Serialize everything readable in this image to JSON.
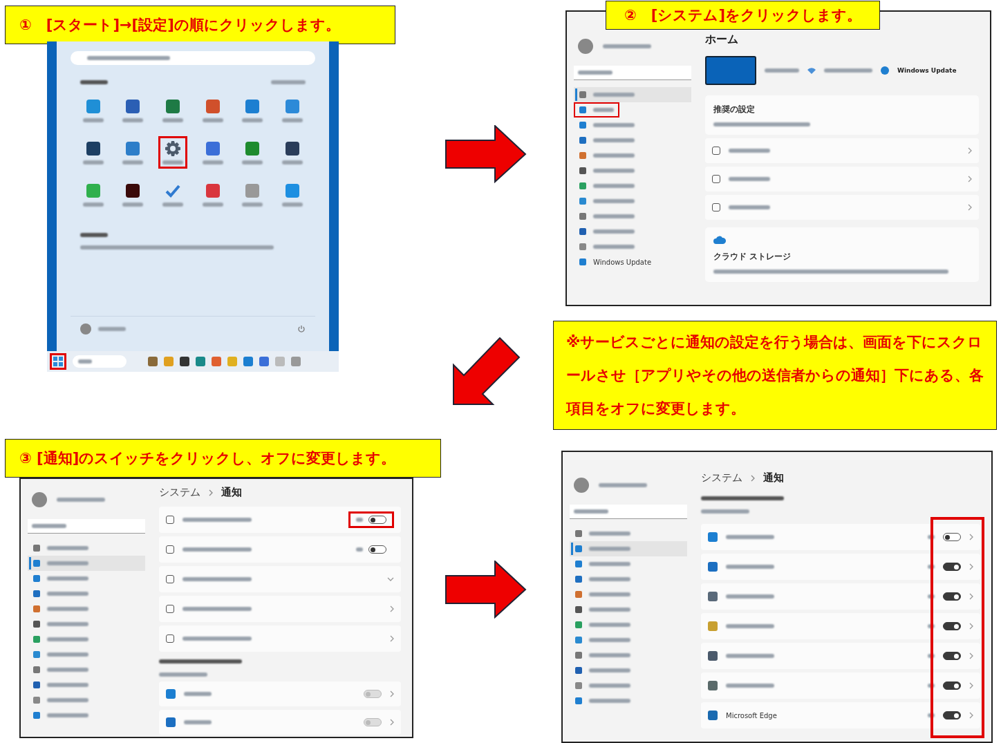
{
  "step1": {
    "caption": "①　[スタート]→[設定]の順にクリックします。",
    "tiles": [
      {
        "kind": "app",
        "color": "#1f8fd6",
        "highlighted": false
      },
      {
        "kind": "app",
        "color": "#2b5fb4",
        "highlighted": false
      },
      {
        "kind": "app",
        "color": "#1e7a45",
        "highlighted": false
      },
      {
        "kind": "app",
        "color": "#d0502b",
        "highlighted": false
      },
      {
        "kind": "app",
        "color": "#1c7fd1",
        "highlighted": false
      },
      {
        "kind": "app",
        "color": "#2c8ad8",
        "highlighted": false
      },
      {
        "kind": "app",
        "color": "#1d3f63",
        "highlighted": false
      },
      {
        "kind": "app",
        "color": "#2d7ec9",
        "highlighted": false
      },
      {
        "kind": "gear",
        "color": "#4b5a6b",
        "highlighted": true
      },
      {
        "kind": "app",
        "color": "#3b6fd8",
        "highlighted": false
      },
      {
        "kind": "app",
        "color": "#1e8b2e",
        "highlighted": false
      },
      {
        "kind": "app",
        "color": "#2a3d5a",
        "highlighted": false
      },
      {
        "kind": "app",
        "color": "#2fb04d",
        "highlighted": false
      },
      {
        "kind": "app",
        "color": "#3a0a0a",
        "highlighted": false
      },
      {
        "kind": "check",
        "color": "#2f7ad0",
        "highlighted": false
      },
      {
        "kind": "app",
        "color": "#d9363e",
        "highlighted": false
      },
      {
        "kind": "app",
        "color": "#999999",
        "highlighted": false
      },
      {
        "kind": "app",
        "color": "#1d8fe1",
        "highlighted": false
      }
    ],
    "start_highlighted": true,
    "taskbar_icons": [
      {
        "color": "#8a6a3a"
      },
      {
        "color": "#e0a020"
      },
      {
        "color": "#333333"
      },
      {
        "color": "#1a8a8a"
      },
      {
        "color": "#e06030"
      },
      {
        "color": "#e0b020"
      },
      {
        "color": "#1c7fd1"
      },
      {
        "color": "#3b6fd8"
      },
      {
        "color": "#bbbbbb"
      },
      {
        "color": "#999999"
      }
    ]
  },
  "step2": {
    "caption": "②　[システム]をクリックします。",
    "title": "ホーム",
    "update_label": "Windows Update",
    "recommended_title": "推奨の設定",
    "cloud_title": "クラウド ストレージ",
    "sidebar": [
      {
        "color": "#777777",
        "selected": true,
        "highlighted": false
      },
      {
        "color": "#1f7fd0",
        "selected": false,
        "highlighted": true
      },
      {
        "color": "#1f7fd0",
        "selected": false,
        "highlighted": false
      },
      {
        "color": "#1f6fc0",
        "selected": false,
        "highlighted": false
      },
      {
        "color": "#d07030",
        "selected": false,
        "highlighted": false
      },
      {
        "color": "#555555",
        "selected": false,
        "highlighted": false
      },
      {
        "color": "#2aa060",
        "selected": false,
        "highlighted": false
      },
      {
        "color": "#2a8ad0",
        "selected": false,
        "highlighted": false
      },
      {
        "color": "#777777",
        "selected": false,
        "highlighted": false
      },
      {
        "color": "#2060b0",
        "selected": false,
        "highlighted": false
      },
      {
        "color": "#888888",
        "selected": false,
        "highlighted": false
      },
      {
        "color": "#1f7fd0",
        "selected": false,
        "highlighted": false,
        "label": "Windows Update"
      }
    ]
  },
  "note": "※サービスごとに通知の設定を行う場合は、画面を下にスクロールさせ［アプリやその他の送信者からの通知］下にある、各項目をオフに変更します。",
  "step3": {
    "caption": "③ [通知]のスイッチをクリックし、オフに変更します。",
    "crumb": "システム",
    "title": "通知",
    "sidebar": [
      {
        "color": "#777777",
        "selected": false,
        "highlighted": false
      },
      {
        "color": "#1f7fd0",
        "selected": true,
        "highlighted": false
      },
      {
        "color": "#1f7fd0",
        "selected": false,
        "highlighted": false
      },
      {
        "color": "#1f6fc0",
        "selected": false,
        "highlighted": false
      },
      {
        "color": "#d07030",
        "selected": false,
        "highlighted": false
      },
      {
        "color": "#555555",
        "selected": false,
        "highlighted": false
      },
      {
        "color": "#2aa060",
        "selected": false,
        "highlighted": false
      },
      {
        "color": "#2a8ad0",
        "selected": false,
        "highlighted": false
      },
      {
        "color": "#777777",
        "selected": false,
        "highlighted": false
      },
      {
        "color": "#2060b0",
        "selected": false,
        "highlighted": false
      },
      {
        "color": "#888888",
        "selected": false,
        "highlighted": false
      },
      {
        "color": "#1f7fd0",
        "selected": false,
        "highlighted": false
      }
    ],
    "settings": [
      {
        "kind": "toggle",
        "on": false,
        "highlighted": true
      },
      {
        "kind": "toggle",
        "on": false,
        "highlighted": false
      },
      {
        "kind": "expand",
        "highlighted": false
      },
      {
        "kind": "link",
        "highlighted": false
      },
      {
        "kind": "link",
        "highlighted": false
      }
    ],
    "apps": [
      {
        "color": "#1c7fd1",
        "on": false,
        "disabled": true
      },
      {
        "color": "#1c6fc1",
        "on": false,
        "disabled": true
      }
    ]
  },
  "step4": {
    "crumb": "システム",
    "title": "通知",
    "toggles_highlighted": true,
    "sidebar": [
      {
        "color": "#777777",
        "selected": false,
        "highlighted": false
      },
      {
        "color": "#1f7fd0",
        "selected": true,
        "highlighted": false
      },
      {
        "color": "#1f7fd0",
        "selected": false,
        "highlighted": false
      },
      {
        "color": "#1f6fc0",
        "selected": false,
        "highlighted": false
      },
      {
        "color": "#d07030",
        "selected": false,
        "highlighted": false
      },
      {
        "color": "#555555",
        "selected": false,
        "highlighted": false
      },
      {
        "color": "#2aa060",
        "selected": false,
        "highlighted": false
      },
      {
        "color": "#2a8ad0",
        "selected": false,
        "highlighted": false
      },
      {
        "color": "#777777",
        "selected": false,
        "highlighted": false
      },
      {
        "color": "#2060b0",
        "selected": false,
        "highlighted": false
      },
      {
        "color": "#888888",
        "selected": false,
        "highlighted": false
      },
      {
        "color": "#1f7fd0",
        "selected": false,
        "highlighted": false
      }
    ],
    "apps": [
      {
        "color": "#1c7fd1",
        "on": false
      },
      {
        "color": "#1c6fc1",
        "on": true
      },
      {
        "color": "#5a6a7a",
        "on": true
      },
      {
        "color": "#c8a030",
        "on": true
      },
      {
        "color": "#4b5a6b",
        "on": true
      },
      {
        "color": "#5a6a6a",
        "on": true
      },
      {
        "color": "#1a6ab0",
        "on": true,
        "label": "Microsoft Edge"
      }
    ]
  }
}
